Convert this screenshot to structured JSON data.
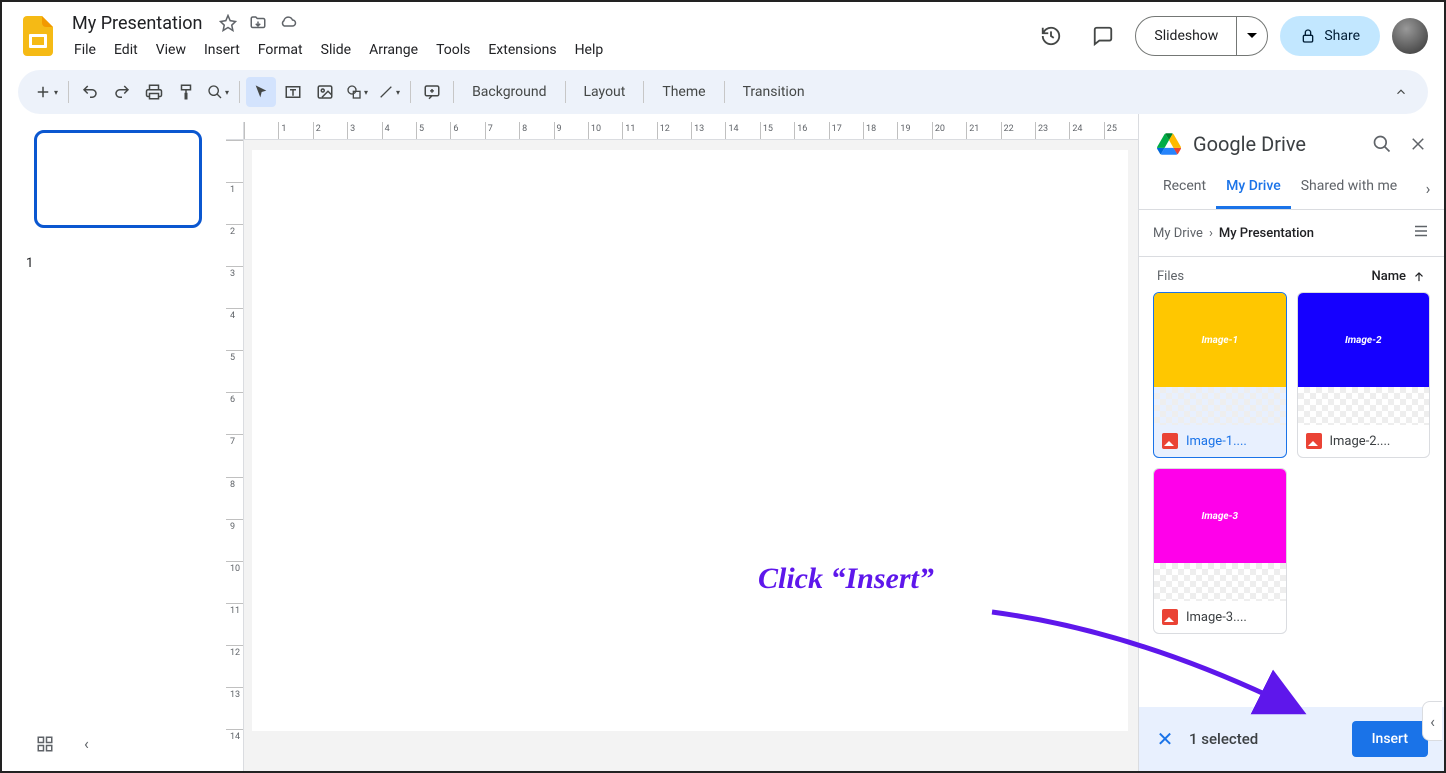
{
  "doc": {
    "title": "My Presentation"
  },
  "menus": [
    "File",
    "Edit",
    "View",
    "Insert",
    "Format",
    "Slide",
    "Arrange",
    "Tools",
    "Extensions",
    "Help"
  ],
  "header_buttons": {
    "slideshow": "Slideshow",
    "share": "Share"
  },
  "toolbar_text": {
    "background": "Background",
    "layout": "Layout",
    "theme": "Theme",
    "transition": "Transition"
  },
  "ruler_h": [
    "",
    "1",
    "2",
    "3",
    "4",
    "5",
    "6",
    "7",
    "8",
    "9",
    "10",
    "11",
    "12",
    "13",
    "14",
    "15",
    "16",
    "17",
    "18",
    "19",
    "20",
    "21",
    "22",
    "23",
    "24",
    "25"
  ],
  "ruler_v": [
    "",
    "1",
    "2",
    "3",
    "4",
    "5",
    "6",
    "7",
    "8",
    "9",
    "10",
    "11",
    "12",
    "13",
    "14"
  ],
  "slide_number": "1",
  "drive": {
    "title": "Google Drive",
    "tabs": [
      "Recent",
      "My Drive",
      "Shared with me"
    ],
    "active_tab": 1,
    "crumb_root": "My Drive",
    "crumb_current": "My Presentation",
    "files_label": "Files",
    "sort_label": "Name",
    "files": [
      {
        "preview_text": "Image-1",
        "label": "Image-1....",
        "color": "#ffc700",
        "selected": true
      },
      {
        "preview_text": "Image-2",
        "label": "Image-2....",
        "color": "#1500ff",
        "selected": false
      },
      {
        "preview_text": "Image-3",
        "label": "Image-3....",
        "color": "#ff00ea",
        "selected": false
      }
    ],
    "selection_text": "1 selected",
    "insert_label": "Insert"
  },
  "annotation": "Click “Insert”"
}
